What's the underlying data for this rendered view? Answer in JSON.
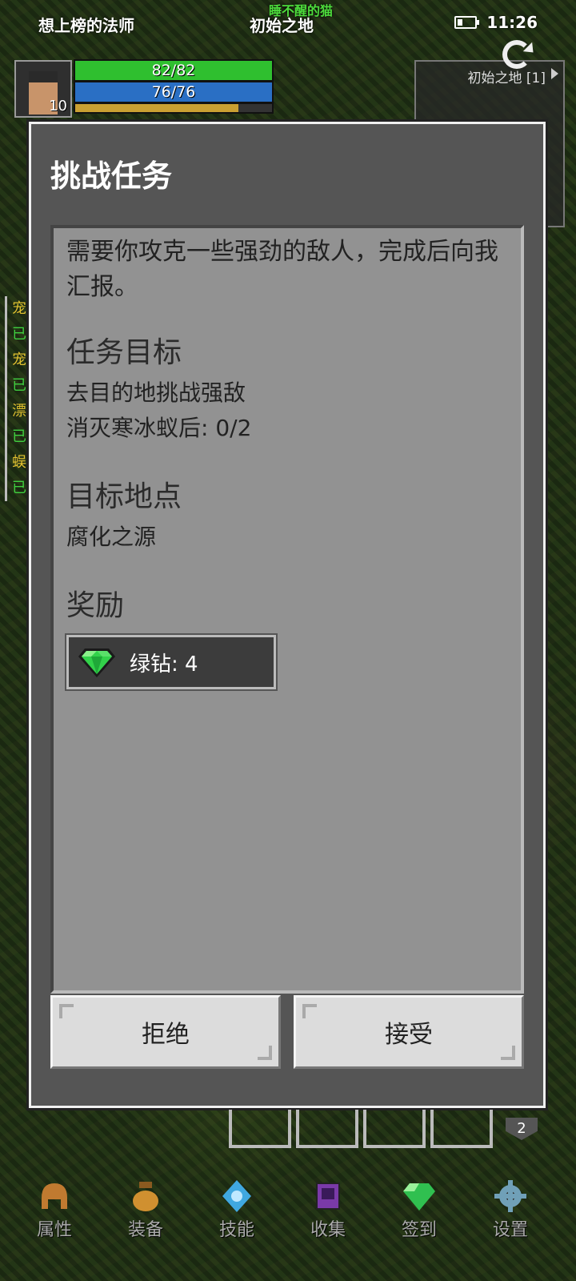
{
  "status_bar": {
    "left_title": "想上榜的法师",
    "map_name": "初始之地",
    "time": "11:26",
    "overhead_name": "睡不醒的猫"
  },
  "player": {
    "level": "10",
    "hp_text": "82/82",
    "mp_text": "76/76",
    "xp_fraction": 0.83
  },
  "minimap": {
    "label": "初始之地 [1]"
  },
  "tracker": [
    {
      "text": "宠",
      "color": "yellow"
    },
    {
      "text": "已",
      "color": "green"
    },
    {
      "text": "宠",
      "color": "yellow"
    },
    {
      "text": "已",
      "color": "green"
    },
    {
      "text": "漂",
      "color": "yellow"
    },
    {
      "text": "已",
      "color": "green"
    },
    {
      "text": "蜈",
      "color": "yellow"
    },
    {
      "text": "已",
      "color": "green"
    }
  ],
  "dialog": {
    "title": "挑战任务",
    "description": "需要你攻克一些强劲的敌人，完成后向我汇报。",
    "objective_heading": "任务目标",
    "objective_line1": "去目的地挑战强敌",
    "objective_line2": "消灭寒冰蚁后: 0/2",
    "location_heading": "目标地点",
    "location": "腐化之源",
    "reward_heading": "奖励",
    "reward_text": "绿钻: 4",
    "reward_icon": "green-diamond-icon",
    "reject_label": "拒绝",
    "accept_label": "接受"
  },
  "slots_badge": "2",
  "bottom_nav": [
    {
      "label": "属性",
      "icon": "helmet-icon",
      "color": "#c07a30"
    },
    {
      "label": "装备",
      "icon": "bag-icon",
      "color": "#d09030"
    },
    {
      "label": "技能",
      "icon": "skill-orb-icon",
      "color": "#40a8e0"
    },
    {
      "label": "收集",
      "icon": "book-icon",
      "color": "#7a3aa8"
    },
    {
      "label": "签到",
      "icon": "green-diamond-icon",
      "color": "#30c050"
    },
    {
      "label": "设置",
      "icon": "gear-icon",
      "color": "#70a0b8"
    }
  ]
}
